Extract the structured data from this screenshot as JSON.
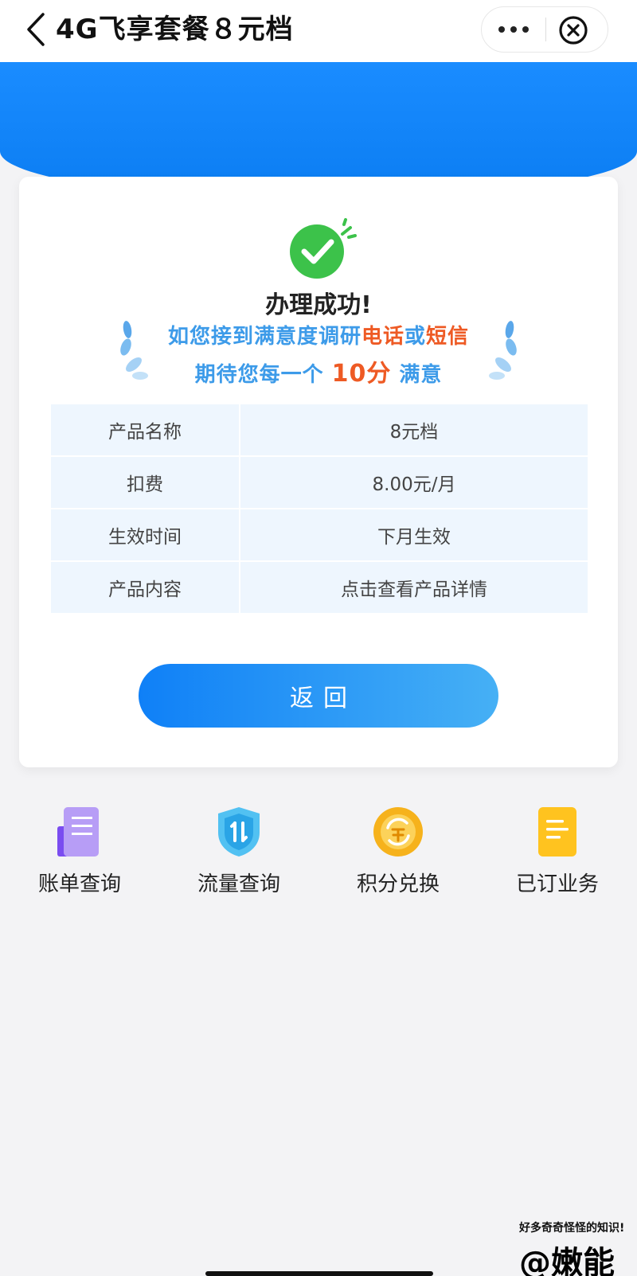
{
  "header": {
    "title": "4G飞享套餐８元档"
  },
  "result": {
    "title": "办理成功!",
    "survey_line1_prefix": "如您接到满意度调研",
    "survey_line1_hl1": "电话",
    "survey_line1_mid": "或",
    "survey_line1_hl2": "短信",
    "survey_line2_prefix": "期待您每一个 ",
    "survey_line2_hl": "10分",
    "survey_line2_suffix": " 满意"
  },
  "info_rows": [
    {
      "key": "产品名称",
      "value": "8元档"
    },
    {
      "key": "扣费",
      "value": "8.00元/月"
    },
    {
      "key": "生效时间",
      "value": "下月生效"
    },
    {
      "key": "产品内容",
      "value": "点击查看产品详情"
    }
  ],
  "return_button": {
    "label": "返回"
  },
  "shortcuts": [
    {
      "label": "账单查询",
      "icon": "bill-icon"
    },
    {
      "label": "流量查询",
      "icon": "data-traffic-icon"
    },
    {
      "label": "积分兑换",
      "icon": "points-exchange-icon"
    },
    {
      "label": "已订业务",
      "icon": "subscribed-services-icon"
    }
  ],
  "watermark": {
    "line1": "好多奇奇怪怪的知识!",
    "line2": "@嫩能"
  },
  "colors": {
    "brand_blue": "#0b7df2",
    "success_green": "#3cc24a",
    "highlight_orange": "#ee5a24",
    "survey_blue": "#3d9be9"
  }
}
